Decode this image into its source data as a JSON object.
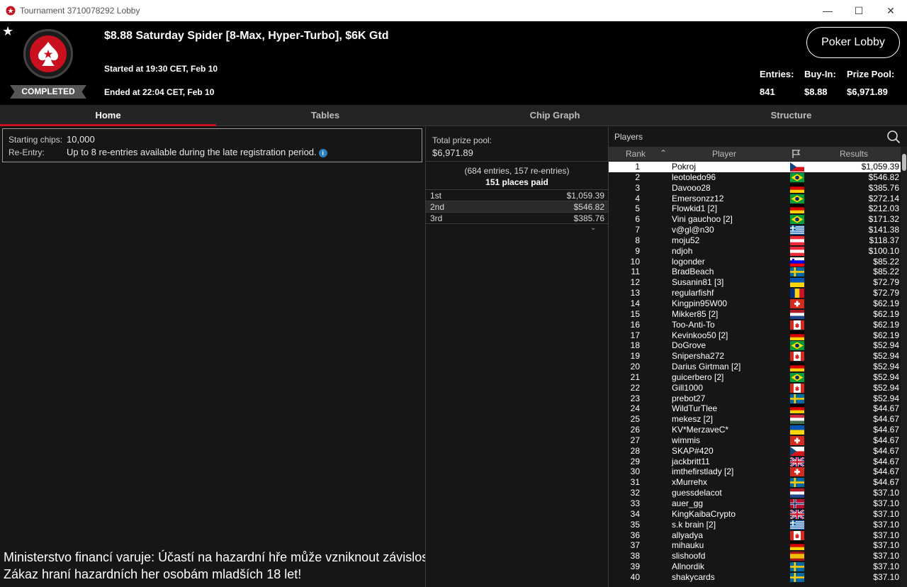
{
  "window": {
    "title": "Tournament 3710078292 Lobby"
  },
  "header": {
    "tournament_name": "$8.88 Saturday Spider [8-Max, Hyper-Turbo], $6K Gtd",
    "started": "Started at 19:30 CET, Feb 10",
    "ended": "Ended at 22:04 CET, Feb 10",
    "status_badge": "COMPLETED",
    "lobby_button": "Poker Lobby",
    "stats": {
      "entries_label": "Entries:",
      "entries_value": "841",
      "buyin_label": "Buy-In:",
      "buyin_value": "$8.88",
      "prize_label": "Prize Pool:",
      "prize_value": "$6,971.89"
    }
  },
  "tabs": [
    "Home",
    "Tables",
    "Chip Graph",
    "Structure"
  ],
  "home": {
    "starting_chips_label": "Starting chips:",
    "starting_chips_value": "10,000",
    "reentry_label": "Re-Entry:",
    "reentry_value": "Up to 8 re-entries available during the late registration period.",
    "warning_line1": "Ministerstvo financí varuje: Účastí na hazardní hře může vzniknout závislost!",
    "warning_line2": "Zákaz hraní hazardních her osobám mladších 18 let!"
  },
  "prize_pool": {
    "label": "Total prize pool:",
    "value": "$6,971.89",
    "entries_note": "(684 entries, 157 re-entries)",
    "places_paid": "151 places paid",
    "places": [
      {
        "place": "1st",
        "amount": "$1,059.39"
      },
      {
        "place": "2nd",
        "amount": "$546.82"
      },
      {
        "place": "3rd",
        "amount": "$385.76"
      }
    ]
  },
  "players": {
    "title": "Players",
    "columns": {
      "rank": "Rank",
      "player": "Player",
      "results": "Results"
    },
    "rows": [
      {
        "rank": "1",
        "name": "Pokroj",
        "flag": "cz",
        "result": "$1,059.39"
      },
      {
        "rank": "2",
        "name": "leotoledo96",
        "flag": "br",
        "result": "$546.82"
      },
      {
        "rank": "3",
        "name": "Davooo28",
        "flag": "de",
        "result": "$385.76"
      },
      {
        "rank": "4",
        "name": "Emersonzz12",
        "flag": "br",
        "result": "$272.14"
      },
      {
        "rank": "5",
        "name": "Flowkid1 [2]",
        "flag": "de",
        "result": "$212.03"
      },
      {
        "rank": "6",
        "name": "Vini gauchoo [2]",
        "flag": "br",
        "result": "$171.32"
      },
      {
        "rank": "7",
        "name": "v@gl@n30",
        "flag": "gr",
        "result": "$141.38"
      },
      {
        "rank": "8",
        "name": "moju52",
        "flag": "at",
        "result": "$118.37"
      },
      {
        "rank": "9",
        "name": "ndjoh",
        "flag": "at",
        "result": "$100.10"
      },
      {
        "rank": "10",
        "name": "logonder",
        "flag": "si",
        "result": "$85.22"
      },
      {
        "rank": "11",
        "name": "BradBeach",
        "flag": "se",
        "result": "$85.22"
      },
      {
        "rank": "12",
        "name": "Susanin81 [3]",
        "flag": "ua",
        "result": "$72.79"
      },
      {
        "rank": "13",
        "name": "regularfishf",
        "flag": "ro",
        "result": "$72.79"
      },
      {
        "rank": "14",
        "name": "Kingpin95W00",
        "flag": "ch",
        "result": "$62.19"
      },
      {
        "rank": "15",
        "name": "Mikker85 [2]",
        "flag": "nl",
        "result": "$62.19"
      },
      {
        "rank": "16",
        "name": "Too-Anti-To",
        "flag": "ca",
        "result": "$62.19"
      },
      {
        "rank": "17",
        "name": "Kevinkoo50 [2]",
        "flag": "de",
        "result": "$62.19"
      },
      {
        "rank": "18",
        "name": "DoGrove",
        "flag": "br",
        "result": "$52.94"
      },
      {
        "rank": "19",
        "name": "Snipersha272",
        "flag": "ca",
        "result": "$52.94"
      },
      {
        "rank": "20",
        "name": "Darius Girtman [2]",
        "flag": "de",
        "result": "$52.94"
      },
      {
        "rank": "21",
        "name": "guicerbero [2]",
        "flag": "br",
        "result": "$52.94"
      },
      {
        "rank": "22",
        "name": "Gill1000",
        "flag": "ca",
        "result": "$52.94"
      },
      {
        "rank": "23",
        "name": "prebot27",
        "flag": "se",
        "result": "$52.94"
      },
      {
        "rank": "24",
        "name": "WildTurTlee",
        "flag": "de",
        "result": "$44.67"
      },
      {
        "rank": "25",
        "name": "mekesz [2]",
        "flag": "hu",
        "result": "$44.67"
      },
      {
        "rank": "26",
        "name": "KV*MerzaveC*",
        "flag": "ua",
        "result": "$44.67"
      },
      {
        "rank": "27",
        "name": "wimmis",
        "flag": "ch",
        "result": "$44.67"
      },
      {
        "rank": "28",
        "name": "SKAP#420",
        "flag": "cz",
        "result": "$44.67"
      },
      {
        "rank": "29",
        "name": "jackbritt11",
        "flag": "gb",
        "result": "$44.67"
      },
      {
        "rank": "30",
        "name": "imthefirstlady [2]",
        "flag": "ch",
        "result": "$44.67"
      },
      {
        "rank": "31",
        "name": "xMurrehx",
        "flag": "se",
        "result": "$44.67"
      },
      {
        "rank": "32",
        "name": "guessdelacot",
        "flag": "nl",
        "result": "$37.10"
      },
      {
        "rank": "33",
        "name": "auer_gg",
        "flag": "no",
        "result": "$37.10"
      },
      {
        "rank": "34",
        "name": "KingKaibaCrypto",
        "flag": "gb",
        "result": "$37.10"
      },
      {
        "rank": "35",
        "name": "s.k brain [2]",
        "flag": "gr",
        "result": "$37.10"
      },
      {
        "rank": "36",
        "name": "allyadya",
        "flag": "ca",
        "result": "$37.10"
      },
      {
        "rank": "37",
        "name": "mihauku",
        "flag": "de",
        "result": "$37.10"
      },
      {
        "rank": "38",
        "name": "slishoofd",
        "flag": "es",
        "result": "$37.10"
      },
      {
        "rank": "39",
        "name": "Allnordik",
        "flag": "se",
        "result": "$37.10"
      },
      {
        "rank": "40",
        "name": "shakycards",
        "flag": "se",
        "result": "$37.10"
      }
    ]
  },
  "colors": {
    "accent": "#c8101e",
    "background": "#161616",
    "header": "#000000",
    "selected_row": "#ffffff"
  }
}
